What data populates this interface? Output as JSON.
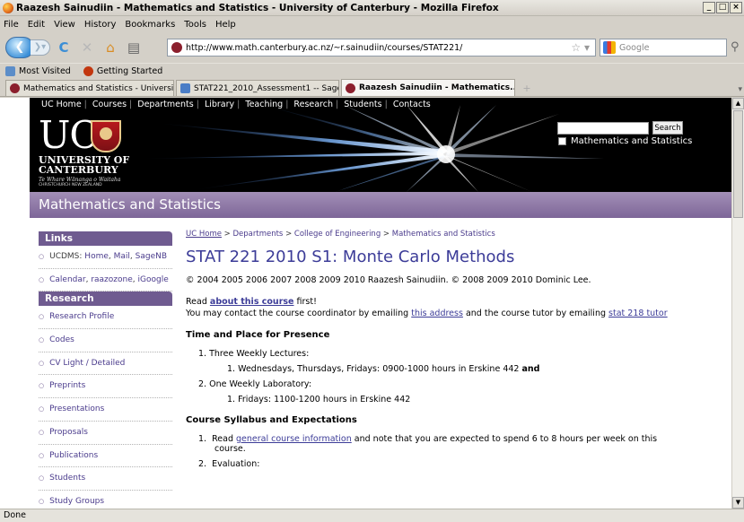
{
  "window": {
    "title": "Raazesh Sainudiin - Mathematics and Statistics - University of Canterbury - Mozilla Firefox",
    "buttons": [
      "_",
      "□",
      "×"
    ]
  },
  "menu": [
    "File",
    "Edit",
    "View",
    "History",
    "Bookmarks",
    "Tools",
    "Help"
  ],
  "nav": {
    "url": "http://www.math.canterbury.ac.nz/~r.sainudiin/courses/STAT221/",
    "search_placeholder": "Google"
  },
  "bookmarks": [
    "Most Visited",
    "Getting Started"
  ],
  "tabs": [
    {
      "label": "Mathematics and Statistics - University ...",
      "active": false
    },
    {
      "label": "STAT221_2010_Assessment1 -- Sage",
      "active": false
    },
    {
      "label": "Raazesh Sainudiin - Mathematics...",
      "active": true
    }
  ],
  "status": "Done",
  "header": {
    "topnav": [
      "UC Home",
      "Courses",
      "Departments",
      "Library",
      "Teaching",
      "Research",
      "Students",
      "Contacts"
    ],
    "logo": {
      "uc": "UC",
      "line1": "UNIVERSITY OF",
      "line2": "CANTERBURY",
      "maori": "Te Whare Wānanga o Waitaha",
      "city": "CHRISTCHURCH NEW ZEALAND"
    },
    "search_button": "Search",
    "search_scope": "Mathematics and Statistics",
    "dept": "Mathematics and Statistics"
  },
  "sidebar": {
    "links_title": "Links",
    "links": [
      {
        "prefix": "UCDMS: ",
        "parts": [
          "Home",
          "Mail",
          "SageNB"
        ]
      },
      {
        "prefix": "",
        "parts": [
          "Calendar",
          "raazozone",
          "iGoogle"
        ]
      }
    ],
    "research_title": "Research",
    "research": [
      "Research Profile",
      "Codes",
      "CV Light / Detailed",
      "Preprints",
      "Presentations",
      "Proposals",
      "Publications",
      "Students",
      "Study Groups"
    ]
  },
  "main": {
    "breadcrumb": [
      "UC Home",
      "Departments",
      "College of Engineering",
      "Mathematics and Statistics"
    ],
    "breadcrumb_sep": ">",
    "title": "STAT 221 2010 S1: Monte Carlo Methods",
    "copyright": "© 2004 2005 2006 2007 2008 2009 2010 Raazesh Sainudiin. © 2008 2009 2010 Dominic Lee.",
    "read_prefix": "Read",
    "read_link": "about this course",
    "read_suffix": "first!",
    "contact_prefix": "You may contact the course coordinator by emailing",
    "contact_link1": "this address",
    "contact_mid": "and the course tutor by emailing",
    "contact_link2": "stat 218 tutor",
    "time_heading": "Time and Place for Presence",
    "time_items": [
      {
        "n": "1.",
        "text": "Three Weekly Lectures:",
        "sub_n": "1.",
        "sub": "Wednesdays, Thursdays, Fridays: 0900-1000 hours in Erskine 442",
        "sub_bold": "and"
      },
      {
        "n": "2.",
        "text": "One Weekly Laboratory:",
        "sub_n": "1.",
        "sub": "Fridays: 1100-1200 hours in Erskine 442",
        "sub_bold": ""
      }
    ],
    "syllabus_heading": "Course Syllabus and Expectations",
    "syl1_prefix": "Read",
    "syl1_link": "general course information",
    "syl1_suffix": "and note that you are expected to spend 6 to 8 hours per week on this course.",
    "syl2": "Evaluation:"
  }
}
